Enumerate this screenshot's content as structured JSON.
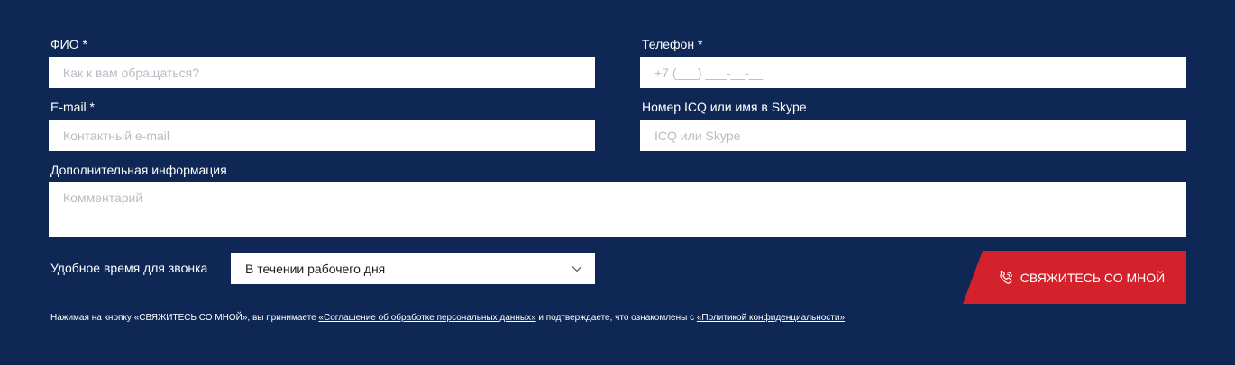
{
  "form": {
    "fio": {
      "label": "ФИО *",
      "placeholder": "Как к вам обращаться?"
    },
    "phone": {
      "label": "Телефон *",
      "placeholder": "+7 (___) ___-__-__"
    },
    "email": {
      "label": "E-mail *",
      "placeholder": "Контактный e-mail"
    },
    "skype": {
      "label": "Номер ICQ или имя в Skype",
      "placeholder": "ICQ или Skype"
    },
    "info": {
      "label": "Дополнительная информация",
      "placeholder": "Комментарий"
    },
    "call_time": {
      "label": "Удобное время для звонка",
      "value": "В течении рабочего дня"
    },
    "submit": {
      "label": "СВЯЖИТЕСЬ СО МНОЙ"
    }
  },
  "consent": {
    "prefix": "Нажимая на кнопку «СВЯЖИТЕСЬ СО МНОЙ», вы принимаете ",
    "agreement_link": "«Соглашение об обработке персональных данных»",
    "middle": " и подтверждаете, что ознакомлены с ",
    "policy_link": "«Политикой конфиденциальности»"
  },
  "colors": {
    "background": "#0e2755",
    "accent": "#d3222b",
    "field": "#ffffff"
  }
}
